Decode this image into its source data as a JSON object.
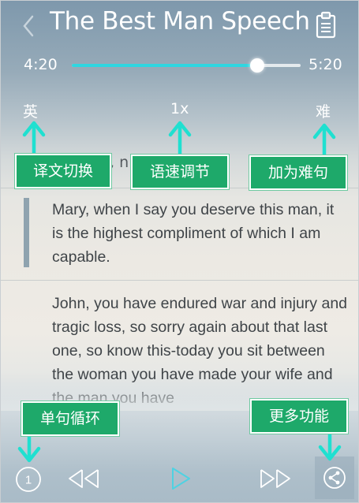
{
  "header": {
    "title": "The Best Man Speech"
  },
  "player": {
    "current_time": "4:20",
    "total_time": "5:20",
    "progress": 0.81
  },
  "controls": {
    "language_toggle": "英",
    "speed": "1x",
    "difficulty": "难"
  },
  "annotations": {
    "translation_switch": "译文切换",
    "speed_adjust": "语速调节",
    "add_difficult": "加为难句",
    "single_loop": "单句循环",
    "more_functions": "更多功能"
  },
  "transcript": {
    "partial_line": ", n",
    "paragraphs": [
      "Mary, when I say you deserve this man, it is the highest compliment of which I am capable.",
      "John, you have endured war and injury and tragic loss, so sorry again about that last one, so know this-today you sit between the woman you have made your wife and the man you have"
    ]
  },
  "bottom_bar": {
    "loop_count": "1"
  },
  "colors": {
    "accent": "#2fd6e0",
    "callout_bg": "#1ea96a",
    "arrow": "#1fe0d0",
    "play_icon": "#4fd2e2"
  }
}
